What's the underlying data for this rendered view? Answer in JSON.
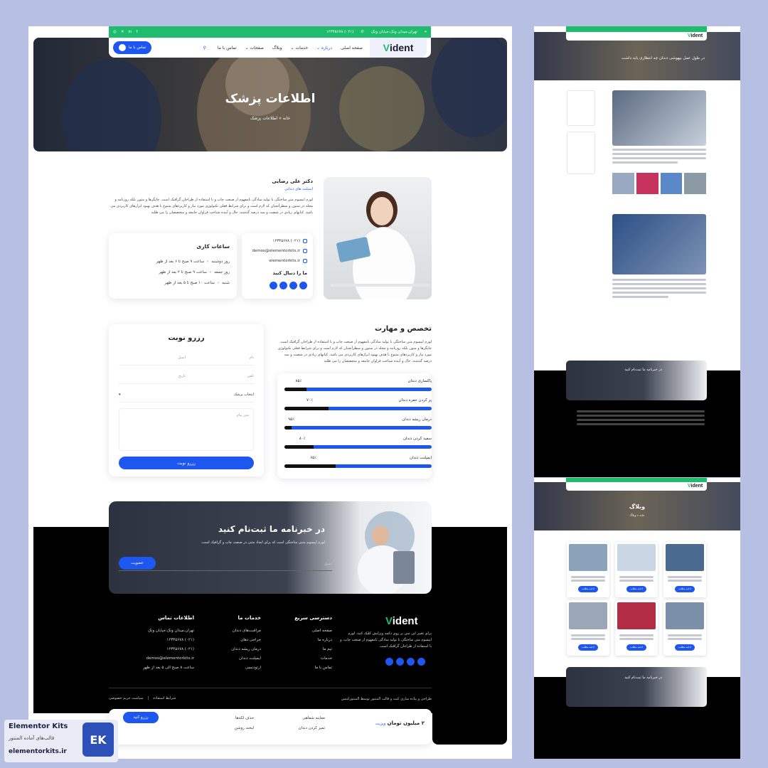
{
  "brand": {
    "logo_v": "V",
    "logo_rest": "ident",
    "accent": "#1e56f0",
    "green": "#1ebc6c"
  },
  "topbar": {
    "address": "تهران،میدان ونک،خیابان ونک",
    "phone": "(۰۲۱) ۱۲۳۴۵۶۷۸",
    "social": [
      "facebook-icon",
      "linkedin-icon",
      "x-icon",
      "instagram-icon"
    ]
  },
  "nav": {
    "items": [
      "صفحه اصلی",
      "درباره",
      "خدمات",
      "وبلاگ",
      "صفحات",
      "تماس با ما"
    ],
    "active": "درباره",
    "cta": "تماس با ما"
  },
  "hero": {
    "title": "اطلاعات پزشک",
    "crumb_home": "خانه",
    "crumb_sep": "»",
    "crumb_current": "اطلاعات پزشک"
  },
  "doctor": {
    "name": "دکتر علی رضایی",
    "role": "ایمپلنت های دندانی",
    "bio": "لورم ایپسوم متن ساختگی با تولید سادگی نامفهوم از صنعت چاپ و با استفاده از طراحان گرافیک است. چاپگرها و متون بلکه روزنامه و مجله در ستون و سطرآنچنان که لازم است و برای شرایط فعلی تکنولوژی مورد نیاز و کاربردهای متنوع با هدف بهبود ابزارهای کاربردی می باشد. کتابهای زیادی در شصت و سه درصد گذشته، حال و آینده شناخت فراوان جامعه و متخصصان را می طلبد",
    "phone": "(۰۲۱) ۱۲۳۴۵۶۷۸",
    "email": "demos@elementorkits.ir",
    "site": "elementorkits.ir",
    "follow": "ما را دنبال کنید"
  },
  "hours": {
    "title": "ساعات کاری",
    "rows": [
      {
        "day": "روز دوشنبه",
        "time": "ساعت ۹ صبح تا ۶ بعد از ظهر"
      },
      {
        "day": "روز جمعه",
        "time": "ساعت ۹ صبح تا ۲ بعد از ظهر"
      },
      {
        "day": "شنبه",
        "time": "ساعت ۱۰ صبح تا ۵ بعد از ظهر"
      }
    ]
  },
  "skills": {
    "title": "تخصص و مهارت",
    "intro": "لورم ایپسوم متن ساختگی با تولید سادگی نامفهوم از صنعت چاپ و با استفاده از طراحان گرافیک است. چاپگرها و متون بلکه روزنامه و مجله در ستون و سطرآنچنان که لازم است و برای شرایط فعلی تکنولوژی مورد نیاز و کاربردهای متنوع با هدف بهبود ابزارهای کاربردی می باشد. کتابهای زیادی در شصت و سه درصد گذشته، حال و آینده شناخت فراوان جامعه و متخصصان را می طلبد",
    "items": [
      {
        "label": "پاکسازی دندان",
        "value": 85,
        "text": "۸۵٪"
      },
      {
        "label": "پر کردن حفره دندان",
        "value": 70,
        "text": "۷۰٪"
      },
      {
        "label": "درمان ریشه دندان",
        "value": 95,
        "text": "۹۵٪"
      },
      {
        "label": "سفید کردن دندان",
        "value": 80,
        "text": "۸۰٪"
      },
      {
        "label": "ایمپلنت دندان",
        "value": 65,
        "text": "۶۵٪"
      }
    ]
  },
  "booking": {
    "title": "رزرو نوبت",
    "name": "نام",
    "email": "ایمیل",
    "phone": "تلفن",
    "date": "تاریخ",
    "doctor": "انتخاب پزشک",
    "message": "متن پیام",
    "submit": "رزرو نوبت"
  },
  "newsletter": {
    "title": "در خبرنامه ما ثبت‌نام کنید",
    "text": "لورم ایپسوم متنی ساختگی است که برای ایجاد متنی در صنعت چاپ و گرافیک است.",
    "placeholder": "ایمیل",
    "button": "عضویت"
  },
  "footer": {
    "about": "برای تغییر این متن بر روی دکمه ویرایش کلیک کنید. لورم ایپسوم متن ساختگی با تولید سادگی نامفهوم از صنعت چاپ، و با استفاده از طراحان گرافیک است.",
    "quick_title": "دسترسی سریع",
    "quick": [
      "صفحه اصلی",
      "درباره ما",
      "تیم ما",
      "خدمات",
      "تماس با ما"
    ],
    "services_title": "خدمات ما",
    "services": [
      "مراقبت‌های دندان",
      "جراحی دهان",
      "درمان ریشه دندان",
      "ایمپلنت دندان",
      "ارتودنسی"
    ],
    "contact_title": "اطلاعات تماس",
    "contact": [
      "تهران،میدان ونک،خیابان ونک",
      "(۰۲۱) ۱۲۳۴۵۶۷۸",
      "(۰۲۱) ۱۲۳۴۵۶۷۸",
      "demos@elementorkits.ir",
      "ساعت ۸ صبح الی ۵ بعد از ظهر"
    ],
    "copyright": "طراحی و پیاده سازی کیت و قالب المنتور توسط المنتورکیتس",
    "terms": "شرایط استفاده",
    "privacy": "سیاست حریم خصوصی"
  },
  "peek": {
    "price": "۲ میلیون تومان",
    "price_suffix": "ویزیت",
    "items": [
      "معاینه شفاهی",
      "حذف لکه‌ها",
      "تمیز کردن دندان",
      "لبخند روشن"
    ],
    "button": "رزرو کنید"
  },
  "blog_preview": {
    "title": "وبلاگ",
    "crumb": "خانه » وبلاگ",
    "post_title": "در طول عمل بیهوشی دندان چه انتظاری باید داشت",
    "cta": "ادامه مطلب"
  },
  "watermark": {
    "line1": "Elementor Kits",
    "line2": "قالب‌های آماده المنتور",
    "line3": "elementorkits.ir"
  }
}
